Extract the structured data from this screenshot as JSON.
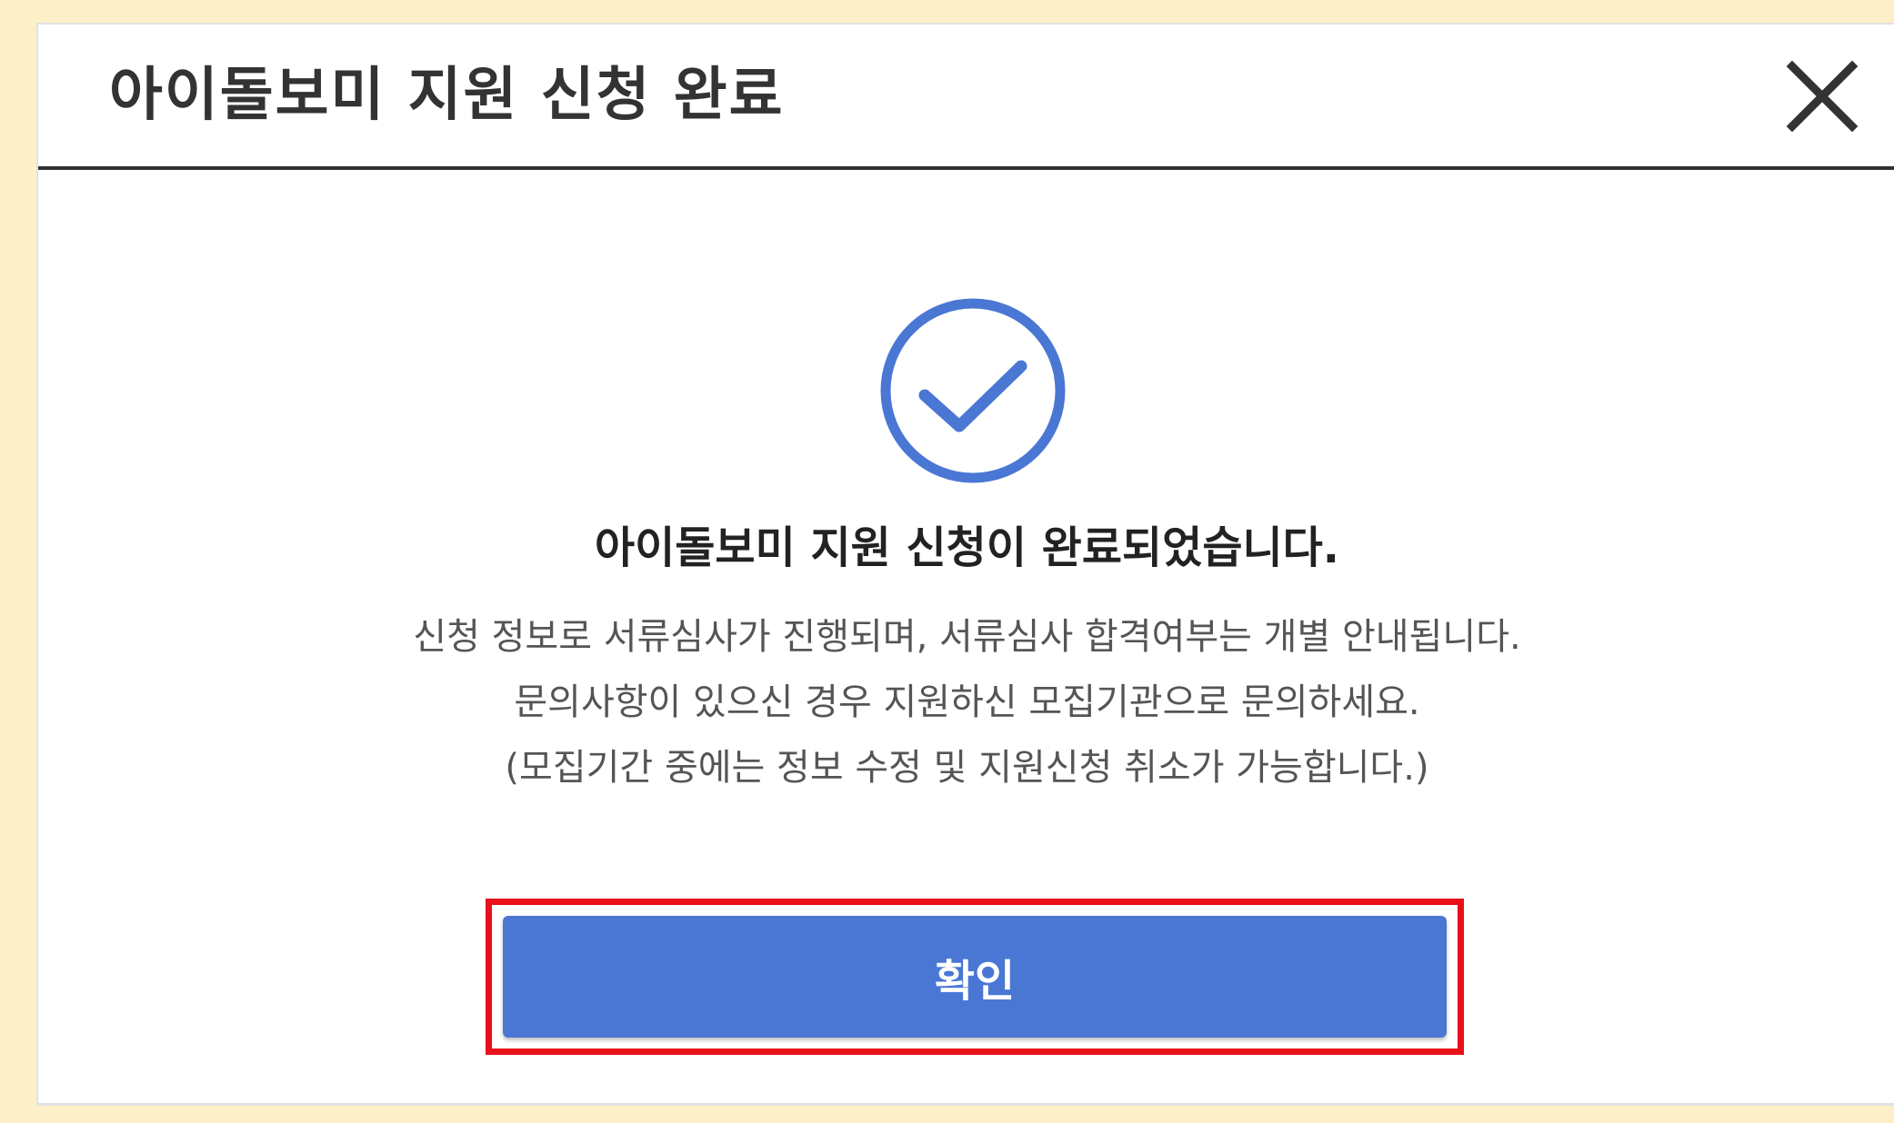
{
  "dialog": {
    "title": "아이돌보미 지원 신청 완료",
    "close_icon": "close-icon"
  },
  "status": {
    "icon": "check-circle-icon",
    "icon_color": "#4a77d4",
    "title": "아이돌보미 지원 신청이 완료되었습니다.",
    "lines": [
      "신청 정보로 서류심사가 진행되며, 서류심사 합격여부는 개별 안내됩니다.",
      "문의사항이 있으신 경우 지원하신 모집기관으로 문의하세요.",
      "(모집기간 중에는 정보 수정 및 지원신청 취소가 가능합니다.)"
    ]
  },
  "actions": {
    "confirm_label": "확인",
    "confirm_color": "#4a77d4",
    "highlight_color": "#e8101a"
  },
  "colors": {
    "page_background": "#fdf0c8",
    "dialog_background": "#ffffff",
    "header_rule": "#333333"
  }
}
